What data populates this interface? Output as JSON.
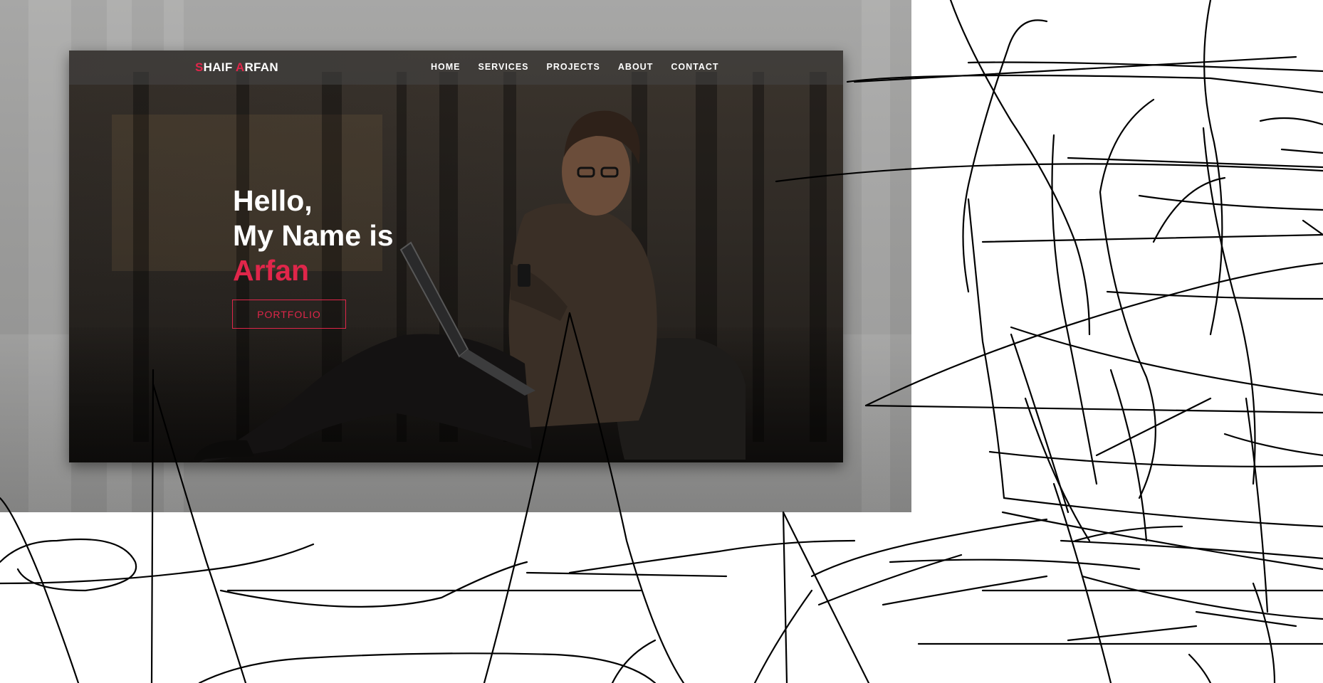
{
  "brand": {
    "first_initial": "S",
    "first_rest": "HAIF ",
    "last_initial": "A",
    "last_rest": "RFAN"
  },
  "nav": {
    "items": [
      "HOME",
      "SERVICES",
      "PROJECTS",
      "ABOUT",
      "CONTACT"
    ]
  },
  "hero": {
    "line1": "Hello,",
    "line2": "My Name is",
    "name": "Arfan",
    "button_label": "PORTFOLIO"
  },
  "colors": {
    "accent": "#e0264a",
    "nav_text": "#ffffff",
    "hero_overlay": "#2f2a25"
  },
  "icons": [
    "laptop-illustration",
    "smartphone-illustration",
    "person-illustration",
    "scribble-overlay"
  ]
}
